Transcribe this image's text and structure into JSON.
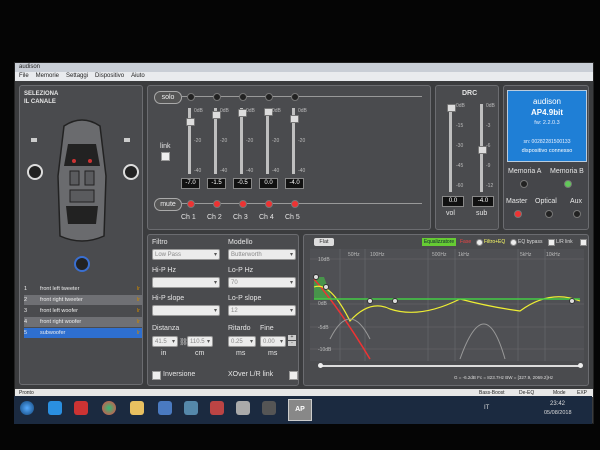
{
  "window": {
    "title": "audison",
    "menu": [
      "File",
      "Memorie",
      "Settaggi",
      "Dispositivo",
      "Aiuto"
    ]
  },
  "channel_select": {
    "title_line1": "SELEZIONA",
    "title_line2": "IL CANALE"
  },
  "channels": [
    {
      "num": "1",
      "label": "front left tweeter",
      "status": "Ir"
    },
    {
      "num": "2",
      "label": "front right tweeter",
      "status": "Ir"
    },
    {
      "num": "3",
      "label": "front left woofer",
      "status": "Ir"
    },
    {
      "num": "4",
      "label": "front right woofer",
      "status": "Ir"
    },
    {
      "num": "5",
      "label": "subwoofer",
      "status": "Ir"
    }
  ],
  "mixer": {
    "solo_label": "solo",
    "mute_label": "mute",
    "link_label": "link",
    "db_scale": [
      "0dB",
      "-20",
      "-40"
    ],
    "channels": [
      {
        "name": "Ch 1",
        "value": "-7.0",
        "level": 0.15
      },
      {
        "name": "Ch 2",
        "value": "-1.5",
        "level": 0.05
      },
      {
        "name": "Ch 3",
        "value": "-0.5",
        "level": 0.02
      },
      {
        "name": "Ch 4",
        "value": "0.0",
        "level": 0.0
      },
      {
        "name": "Ch 5",
        "value": "-4.0",
        "level": 0.1
      }
    ]
  },
  "drc": {
    "title": "DRC",
    "vol_scale": [
      "0dB",
      "-15",
      "-30",
      "-45",
      "-60"
    ],
    "sub_scale": [
      "0dB",
      "-3",
      "-6",
      "-9",
      "-12"
    ],
    "vol_value": "0.0",
    "sub_value": "-4.0",
    "vol_label": "vol",
    "sub_label": "sub"
  },
  "device": {
    "brand": "audison",
    "model": "AP4.9bit",
    "fw": "fw: 2.2.0.3",
    "sn": "sn: 00282281500133",
    "status": "dispositivo connesso"
  },
  "memory": {
    "a_label": "Memoria A",
    "b_label": "Memoria B"
  },
  "sources": {
    "master": "Master",
    "optical": "Optical",
    "aux": "Aux"
  },
  "filter": {
    "filtro_label": "Filtro",
    "filtro_value": "Low Pass",
    "modello_label": "Modello",
    "modello_value": "Butterworth",
    "hp_hz_label": "Hi-P Hz",
    "lp_hz_label": "Lo-P Hz",
    "lp_hz_value": "70",
    "hp_slope_label": "Hi-P slope",
    "lp_slope_label": "Lo-P slope",
    "lp_slope_value": "12",
    "distanza_label": "Distanza",
    "distanza_in": "41.5",
    "distanza_cm": "110.5",
    "in_label": "in",
    "cm_label": "cm",
    "ritardo_label": "Ritardo",
    "fine_label": "Fine",
    "ritardo_value": "0.25",
    "fine_value": "0.00",
    "ms_label": "ms",
    "inversione_label": "Inversione",
    "xover_label": "XOver L/R link"
  },
  "eq": {
    "flat_label": "Flat",
    "equalizzatore": "Equalizzatore",
    "fase": "Fase",
    "filtro_eq": "Filtro+EQ",
    "eq_bypass": "EQ bypass",
    "lr_link": "L/R link",
    "freq_ticks": [
      "50Hz",
      "100Hz",
      "500Hz",
      "1kHz",
      "5kHz",
      "10kHz"
    ],
    "db_ticks": [
      "10dB",
      "0dB",
      "-5dB",
      "-10dB"
    ],
    "readout": "G = -6.2dB   Fc = 823.7Hz   BW = [327.9, 2069.2]Hz"
  },
  "statusbar": {
    "left": "Pronto",
    "items": [
      "Bass-Boost",
      "De-EQ",
      "Mode",
      "EXP"
    ]
  },
  "taskbar": {
    "lang": "IT",
    "time": "23:42",
    "date": "05/08/2018",
    "app_label": "AP"
  }
}
